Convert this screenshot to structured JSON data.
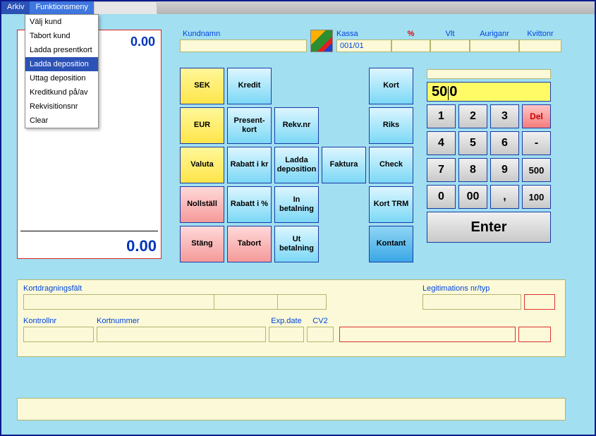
{
  "menubar": {
    "arkiv": "Arkiv",
    "funk": "Funktionsmeny"
  },
  "dropdown": {
    "items": [
      "Välj kund",
      "Tabort kund",
      "Ladda presentkort",
      "Ladda deposition",
      "Uttag deposition",
      "Kreditkund på/av",
      "Rekvisitionsnr",
      "Clear"
    ],
    "selectedIndex": 3
  },
  "receipt": {
    "top": "0.00",
    "bottom": "0.00"
  },
  "header": {
    "labels": {
      "kundnamn": "Kundnamn",
      "kassa": "Kassa",
      "pct": "%",
      "vlt": "Vlt",
      "auriganr": "Auriganr",
      "kvittonr": "Kvittonr"
    },
    "values": {
      "kassa": "001/01"
    }
  },
  "fn": {
    "sek": "SEK",
    "kredit": "Kredit",
    "kort": "Kort",
    "eur": "EUR",
    "presentkort": "Present-\nkort",
    "rekvnr": "Rekv.nr",
    "riks": "Riks",
    "valuta": "Valuta",
    "rabattkr": "Rabatt i kr",
    "laddadep": "Ladda deposition",
    "faktura": "Faktura",
    "check": "Check",
    "nollstall": "Nollställ",
    "rabattpct": "Rabatt i %",
    "inbet": "In betalning",
    "korttrm": "Kort TRM",
    "stang": "Stäng",
    "tabort": "Tabort",
    "utbet": "Ut betalning",
    "kontant": "Kontant"
  },
  "display": {
    "value_before": "50",
    "value_after": "0"
  },
  "keypad": {
    "r1": [
      "1",
      "2",
      "3",
      "Del"
    ],
    "r2": [
      "4",
      "5",
      "6",
      "-"
    ],
    "r3": [
      "7",
      "8",
      "9",
      "500"
    ],
    "r4": [
      "0",
      "00",
      ",",
      "100"
    ],
    "enter": "Enter"
  },
  "card": {
    "kortdrag": "Kortdragningsfält",
    "legit": "Legitimations nr/typ",
    "kontrollnr": "Kontrollnr",
    "kortnummer": "Kortnummer",
    "expdate": "Exp.date",
    "cv2": "CV2"
  }
}
